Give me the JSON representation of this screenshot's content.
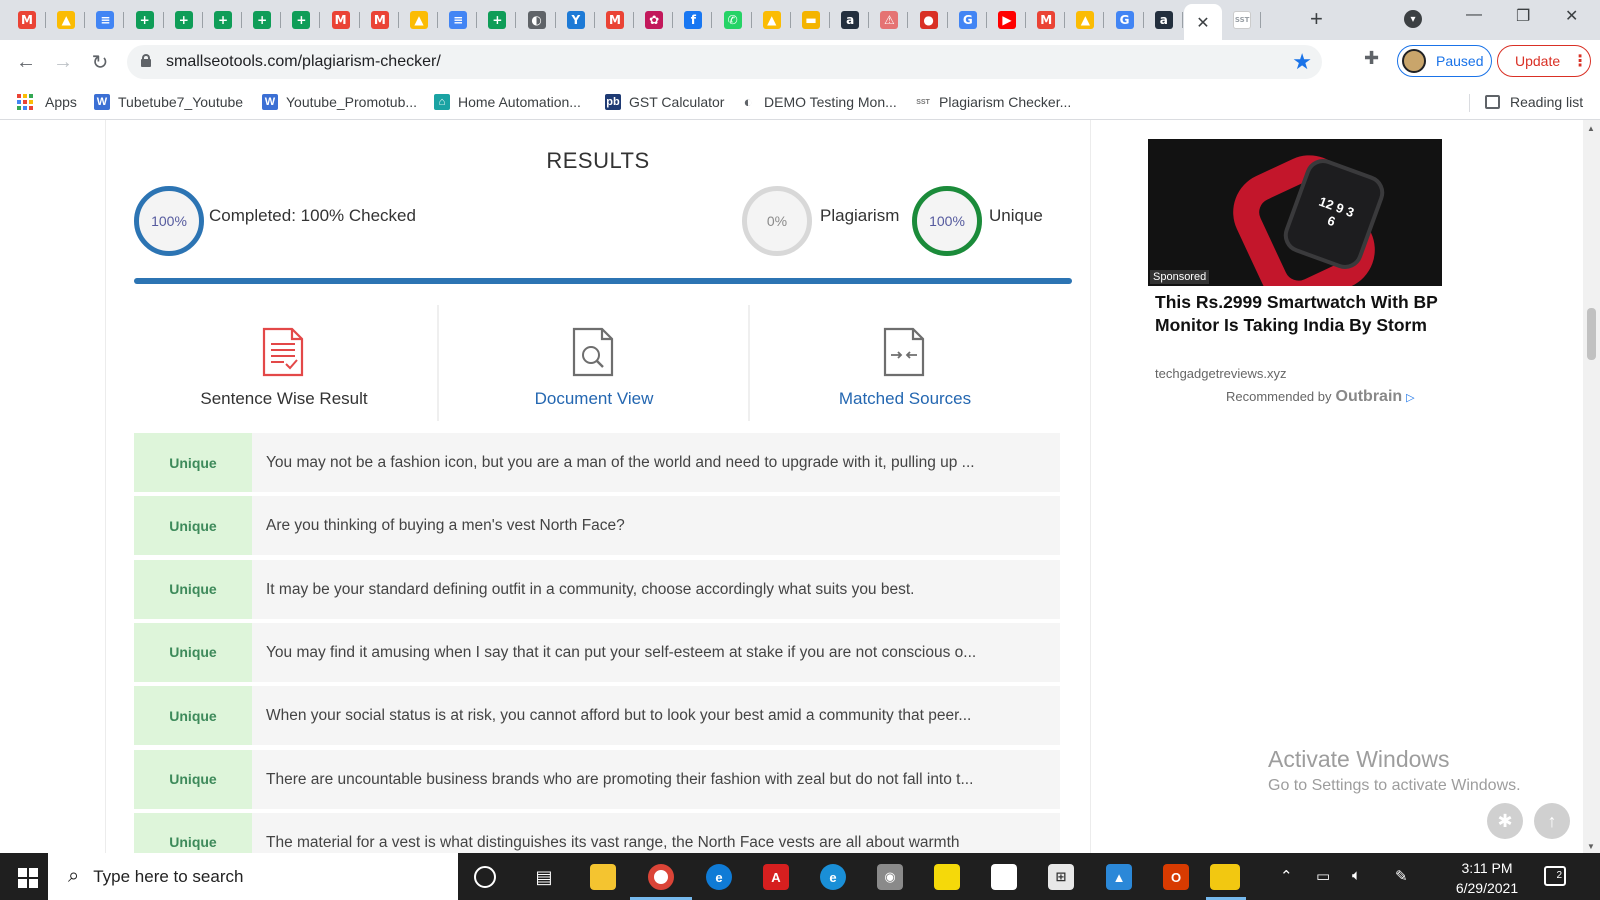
{
  "browser": {
    "tabs": [
      {
        "icon": "gmail-icon",
        "glyph": "M",
        "color": "#ea4335"
      },
      {
        "icon": "drive-icon",
        "glyph": "▲",
        "color": "#fbbc04"
      },
      {
        "icon": "docs-icon",
        "glyph": "≡",
        "color": "#4285f4"
      },
      {
        "icon": "sheets-icon",
        "glyph": "+",
        "color": "#0f9d58"
      },
      {
        "icon": "sheets-icon",
        "glyph": "+",
        "color": "#0f9d58"
      },
      {
        "icon": "sheets-icon",
        "glyph": "+",
        "color": "#0f9d58"
      },
      {
        "icon": "sheets-icon",
        "glyph": "+",
        "color": "#0f9d58"
      },
      {
        "icon": "sheets-icon",
        "glyph": "+",
        "color": "#0f9d58"
      },
      {
        "icon": "gmail-icon",
        "glyph": "M",
        "color": "#ea4335"
      },
      {
        "icon": "gmail-icon",
        "glyph": "M",
        "color": "#ea4335"
      },
      {
        "icon": "drive-icon",
        "glyph": "▲",
        "color": "#fbbc04"
      },
      {
        "icon": "docs-icon",
        "glyph": "≡",
        "color": "#4285f4"
      },
      {
        "icon": "sheets-icon",
        "glyph": "+",
        "color": "#0f9d58"
      },
      {
        "icon": "globe-icon",
        "glyph": "◐",
        "color": "#5f6368"
      },
      {
        "icon": "yammer-icon",
        "glyph": "Y",
        "color": "#1d7ad6"
      },
      {
        "icon": "gmail-icon",
        "glyph": "M",
        "color": "#ea4335"
      },
      {
        "icon": "flower-icon",
        "glyph": "✿",
        "color": "#c2185b"
      },
      {
        "icon": "facebook-icon",
        "glyph": "f",
        "color": "#1877f2"
      },
      {
        "icon": "whatsapp-icon",
        "glyph": "✆",
        "color": "#25d366"
      },
      {
        "icon": "drive-icon",
        "glyph": "▲",
        "color": "#fbbc04"
      },
      {
        "icon": "folder-icon",
        "glyph": "▬",
        "color": "#f4b400"
      },
      {
        "icon": "amazon-icon",
        "glyph": "a",
        "color": "#232f3e"
      },
      {
        "icon": "pdf-icon",
        "glyph": "⚠",
        "color": "#e57373"
      },
      {
        "icon": "tool-icon",
        "glyph": "●",
        "color": "#d93025"
      },
      {
        "icon": "google-icon",
        "glyph": "G",
        "color": "#4285f4"
      },
      {
        "icon": "youtube-icon",
        "glyph": "▶",
        "color": "#ff0000"
      },
      {
        "icon": "gmail-icon",
        "glyph": "M",
        "color": "#ea4335"
      },
      {
        "icon": "drive-icon",
        "glyph": "▲",
        "color": "#fbbc04"
      },
      {
        "icon": "google-icon",
        "glyph": "G",
        "color": "#4285f4"
      },
      {
        "icon": "amazon-icon",
        "glyph": "a",
        "color": "#232f3e"
      },
      {
        "icon": "close-icon",
        "glyph": "✕",
        "color": "#3c4043",
        "active": true
      },
      {
        "icon": "sst-icon",
        "glyph": "SST",
        "color": "#9aa0a6"
      }
    ],
    "url": "smallseotools.com/plagiarism-checker/",
    "paused_label": "Paused",
    "update_label": "Update"
  },
  "bookmarks": [
    {
      "label": "Apps",
      "icon": "apps-icon"
    },
    {
      "label": "Tubetube7_Youtube",
      "icon": "w-icon",
      "glyph": "W",
      "color": "#3b6fd4"
    },
    {
      "label": "Youtube_Promotub...",
      "icon": "w-icon",
      "glyph": "W",
      "color": "#3b6fd4"
    },
    {
      "label": "Home Automation...",
      "icon": "home-icon",
      "glyph": "⌂",
      "color": "#1aa3a3"
    },
    {
      "label": "GST Calculator",
      "icon": "pdf-icon",
      "glyph": "pb",
      "color": "#1f3b74"
    },
    {
      "label": "DEMO Testing Mon...",
      "icon": "globe-icon",
      "glyph": "◐",
      "color": "#5f6368"
    },
    {
      "label": "Plagiarism Checker...",
      "icon": "sst-icon",
      "glyph": "SST",
      "color": "#ffffff"
    }
  ],
  "reading_list": "Reading list",
  "results": {
    "title": "RESULTS",
    "completed_pct": "100%",
    "completed_label": "Completed: 100% Checked",
    "plagiarism_pct": "0%",
    "plagiarism_label": "Plagiarism",
    "unique_pct": "100%",
    "unique_label": "Unique",
    "progress": 1.0,
    "colors": {
      "accent": "#2c74b3",
      "unique_ring": "#1b8b3a",
      "badge_bg": "#def5da",
      "badge_text": "#3d8a5a",
      "link": "#2467b1"
    }
  },
  "view_tabs": [
    {
      "label": "Sentence Wise Result",
      "icon": "document-lines-icon"
    },
    {
      "label": "Document View",
      "icon": "document-search-icon"
    },
    {
      "label": "Matched Sources",
      "icon": "document-compare-icon"
    }
  ],
  "sentences": [
    {
      "status": "Unique",
      "text": "You may not be a fashion icon, but you are a man of the world and need to upgrade with it, pulling up ..."
    },
    {
      "status": "Unique",
      "text": "Are you thinking of buying a men's vest North Face?"
    },
    {
      "status": "Unique",
      "text": "It may be your standard defining outfit in a community, choose accordingly what suits you best."
    },
    {
      "status": "Unique",
      "text": "You may find it amusing when I say that it can put your self-esteem at stake if you are not conscious o..."
    },
    {
      "status": "Unique",
      "text": "When your social status is at risk, you cannot afford but to look your best amid a community that peer..."
    },
    {
      "status": "Unique",
      "text": "There are uncountable business brands who are promoting their fashion with zeal but do not fall into t..."
    },
    {
      "status": "Unique",
      "text": "The material for a vest is what distinguishes its vast range, the North Face vests are all about warmth"
    }
  ],
  "ad": {
    "sponsored": "Sponsored",
    "title": "This Rs.2999 Smartwatch With BP Monitor Is Taking India By Storm",
    "domain": "techgadgetreviews.xyz",
    "recommended": "Recommended by",
    "brand": "Outbrain",
    "watch_face": "12 9 3 6"
  },
  "watermark": {
    "line1": "Activate Windows",
    "line2": "Go to Settings to activate Windows."
  },
  "taskbar": {
    "search_placeholder": "Type here to search",
    "time": "3:11 PM",
    "date": "6/29/2021",
    "notifications": "2"
  }
}
